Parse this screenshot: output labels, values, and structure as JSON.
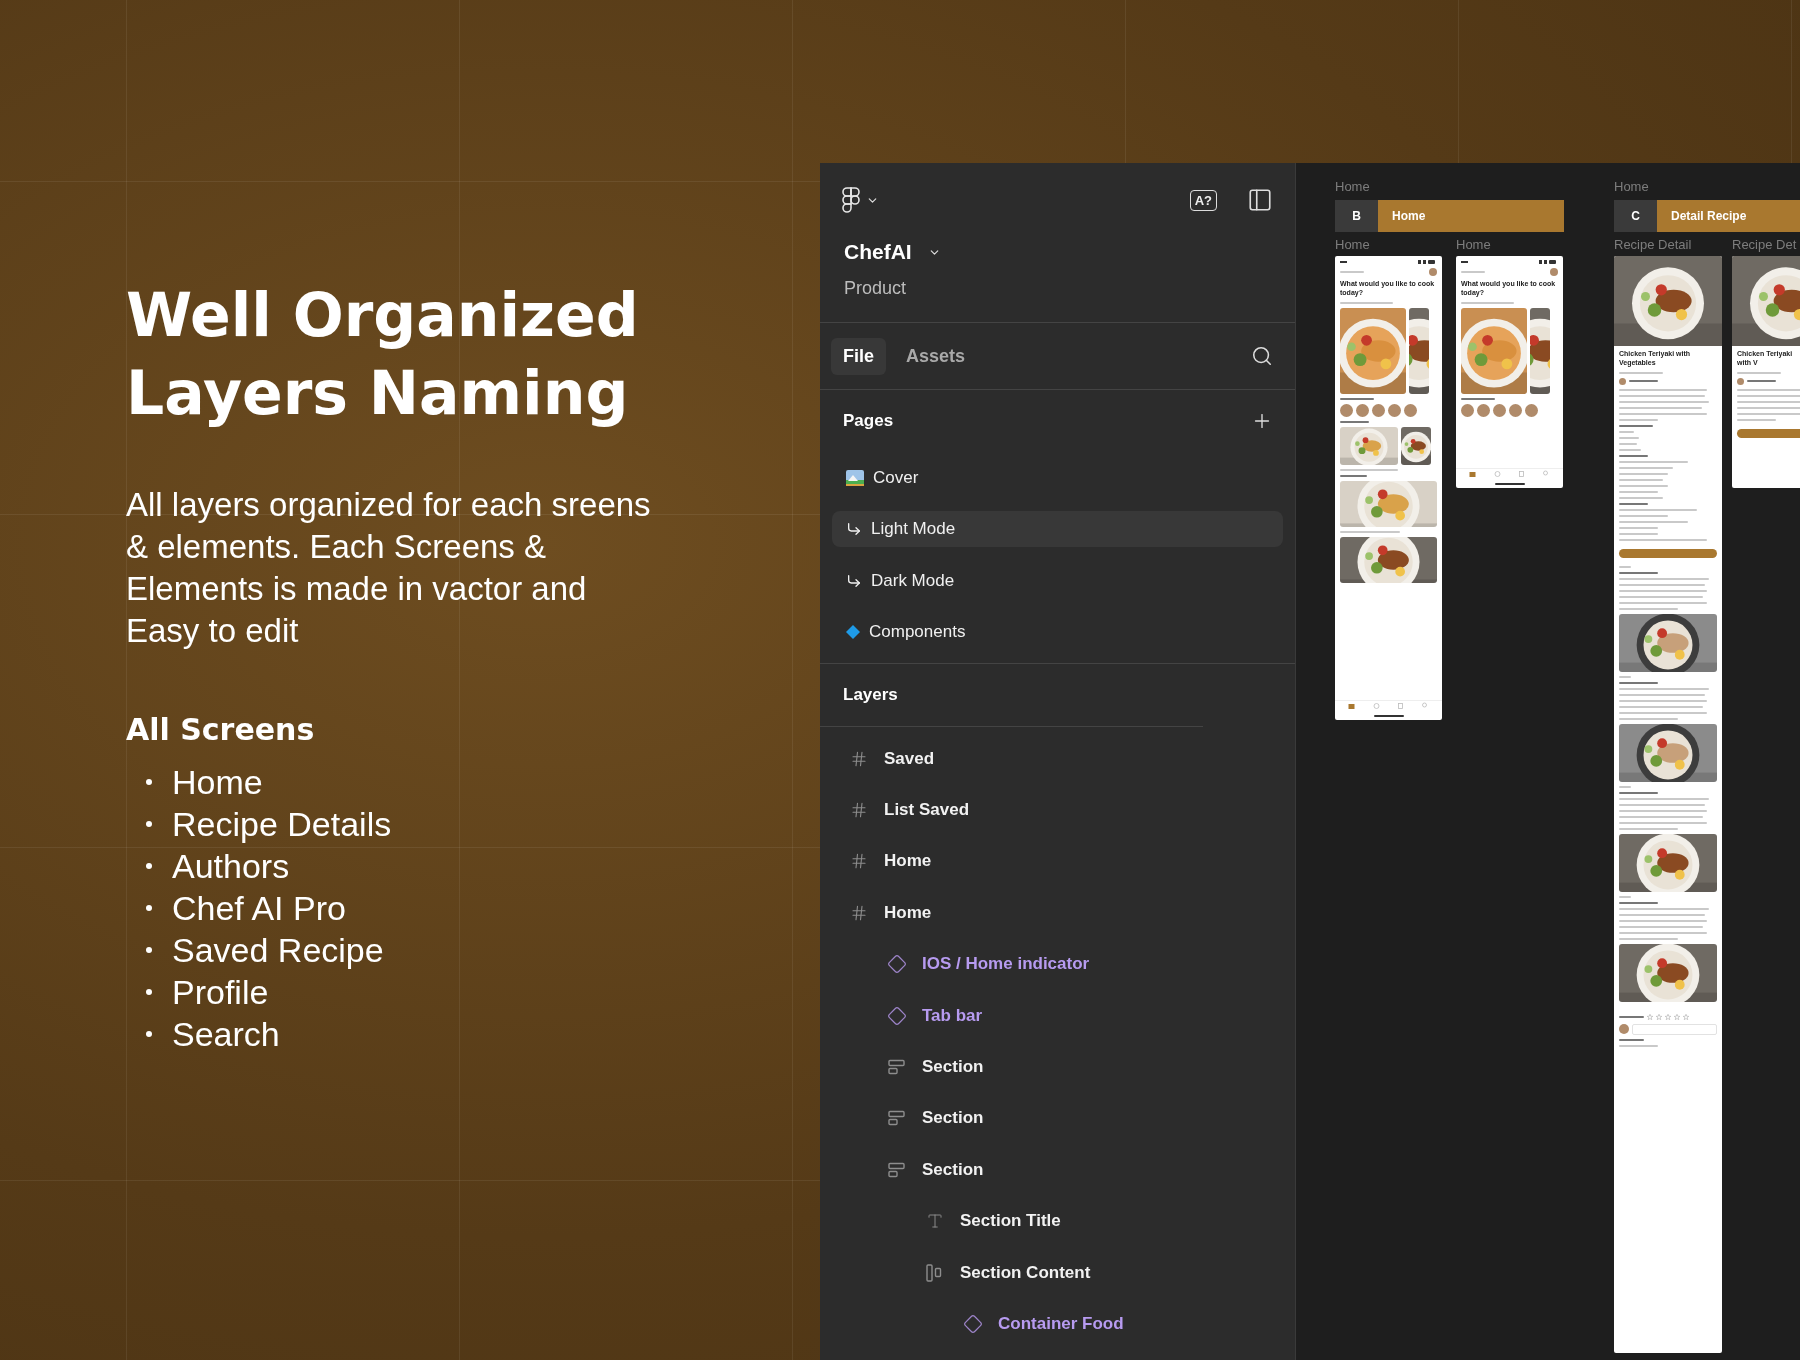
{
  "promo": {
    "title": "Well Organized Layers Naming",
    "description": "All layers organized for each sreens & elements. Each Screens & Elements is made in vactor and Easy to edit",
    "list_title": "All Screens",
    "screens": [
      "Home",
      "Recipe Details",
      "Authors",
      "Chef AI Pro",
      "Saved Recipe",
      "Profile",
      "Search"
    ]
  },
  "panel": {
    "file_name": "ChefAI",
    "project": "Product",
    "ui_badge": "A?",
    "tabs": [
      {
        "label": "File",
        "selected": true
      },
      {
        "label": "Assets",
        "selected": false
      }
    ],
    "pages": {
      "title": "Pages",
      "items": [
        {
          "label": "Cover",
          "kind": "cover",
          "selected": false
        },
        {
          "label": "Light Mode",
          "kind": "subpage",
          "selected": true
        },
        {
          "label": "Dark Mode",
          "kind": "subpage",
          "selected": false
        },
        {
          "label": "Components",
          "kind": "component",
          "selected": false
        }
      ]
    },
    "layers": {
      "title": "Layers",
      "items": [
        {
          "label": "Saved",
          "kind": "frame"
        },
        {
          "label": "List Saved",
          "kind": "frame"
        },
        {
          "label": "Home",
          "kind": "frame"
        },
        {
          "label": "Home",
          "kind": "frame",
          "children": [
            {
              "label": "IOS / Home indicator",
              "kind": "component"
            },
            {
              "label": "Tab bar",
              "kind": "component"
            },
            {
              "label": "Section",
              "kind": "section"
            },
            {
              "label": "Section",
              "kind": "section"
            },
            {
              "label": "Section",
              "kind": "section",
              "children": [
                {
                  "label": "Section Title",
                  "kind": "text"
                },
                {
                  "label": "Section Content",
                  "kind": "row",
                  "children": [
                    {
                      "label": "Container Food",
                      "kind": "component"
                    }
                  ]
                }
              ]
            }
          ]
        }
      ]
    }
  },
  "canvas": {
    "sections": [
      {
        "label": "Home",
        "letter": "B",
        "title": "Home",
        "frames": [
          {
            "label": "Home",
            "kind": "home",
            "long": true,
            "headline": "What would you like to cook today?"
          },
          {
            "label": "Home",
            "kind": "home",
            "long": false,
            "headline": "What would you like to cook today?"
          }
        ]
      },
      {
        "label": "Home",
        "letter": "C",
        "title": "Detail Recipe",
        "frames": [
          {
            "label": "Recipe Detail",
            "kind": "detail",
            "long": true,
            "headline": "Chicken Teriyaki with Vegetables"
          },
          {
            "label": "Recipe Det",
            "kind": "detail",
            "long": false,
            "headline": "Chicken Teriyaki with V"
          }
        ]
      }
    ]
  }
}
